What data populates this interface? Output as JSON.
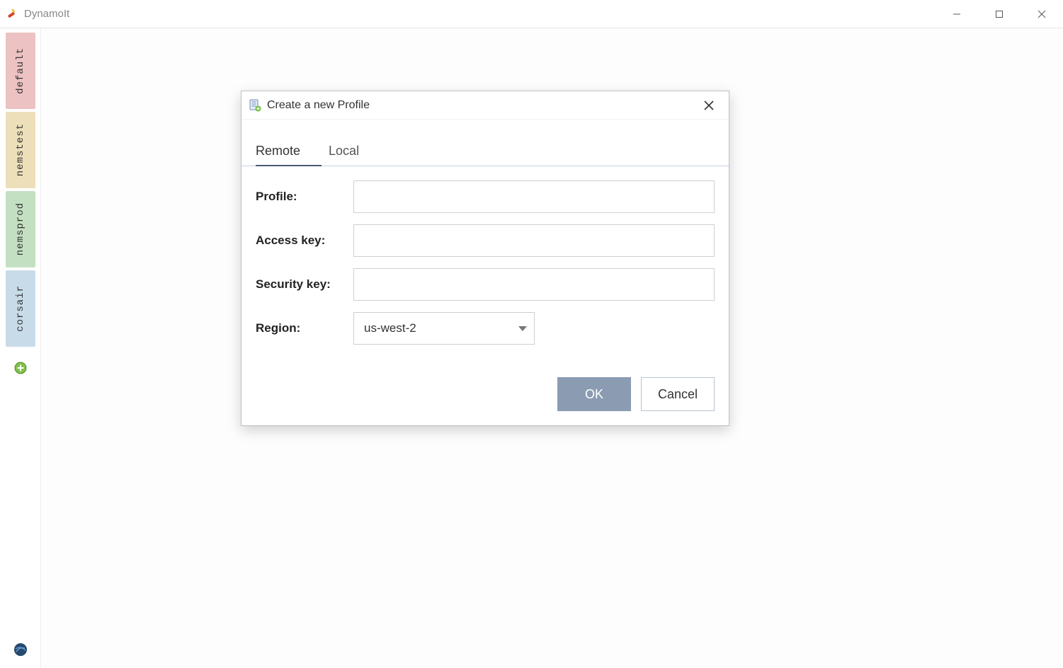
{
  "window": {
    "title": "DynamoIt"
  },
  "sidebar": {
    "profiles": [
      {
        "label": "default",
        "bg": "#edc2c2"
      },
      {
        "label": "nemstest",
        "bg": "#eddfb9"
      },
      {
        "label": "nemsprod",
        "bg": "#c4e0c2"
      },
      {
        "label": "corsair",
        "bg": "#c8dbe9"
      }
    ]
  },
  "dialog": {
    "title": "Create a new Profile",
    "tabs": {
      "remote": "Remote",
      "local": "Local",
      "active": "remote"
    },
    "fields": {
      "profile": {
        "label": "Profile:",
        "value": ""
      },
      "access_key": {
        "label": "Access key:",
        "value": ""
      },
      "security_key": {
        "label": "Security key:",
        "value": ""
      },
      "region": {
        "label": "Region:",
        "value": "us-west-2"
      }
    },
    "buttons": {
      "ok": "OK",
      "cancel": "Cancel"
    }
  }
}
